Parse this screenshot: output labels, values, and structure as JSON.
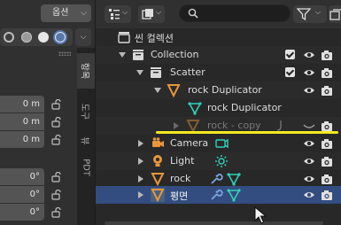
{
  "viewport_header": {
    "options_label": "옵션",
    "shading_modes": [
      "wireframe",
      "solid",
      "material-preview",
      "rendered"
    ],
    "active_shading": "material-preview"
  },
  "properties": {
    "location_values": [
      "0 m",
      "0 m",
      "0 m"
    ],
    "rotation_values": [
      "0°",
      "0°",
      "0°"
    ]
  },
  "sidebar_tabs": [
    {
      "label": "항목",
      "active": true
    },
    {
      "label": "도구",
      "active": false
    },
    {
      "label": "뷰",
      "active": false
    },
    {
      "label": "PDT",
      "active": false
    }
  ],
  "outliner": {
    "search_placeholder": "",
    "rows": [
      {
        "label": "씬 컬렉션",
        "icon": "scene-collection-icon"
      },
      {
        "label": "Collection",
        "icon": "collection-icon",
        "checkbox": true
      },
      {
        "label": "Scatter",
        "icon": "collection-icon",
        "checkbox": true
      },
      {
        "label": "rock Duplicator",
        "icon": "object-icon"
      },
      {
        "label": "rock Duplicator",
        "icon": "mesh-data-icon"
      },
      {
        "label": "rock - copy",
        "icon": "object-icon",
        "disabled": true
      },
      {
        "label": "Camera",
        "icon": "camera-icon"
      },
      {
        "label": "Light",
        "icon": "light-icon"
      },
      {
        "label": "rock",
        "icon": "object-icon"
      },
      {
        "label": "평면",
        "icon": "object-icon",
        "selected": true
      }
    ]
  },
  "colors": {
    "accent_selected": "#334d80",
    "object_orange": "#e8963c",
    "mesh_teal": "#2fd1b8",
    "modifier_blue": "#7da6e0",
    "annotation_yellow": "#f2ea1c"
  }
}
